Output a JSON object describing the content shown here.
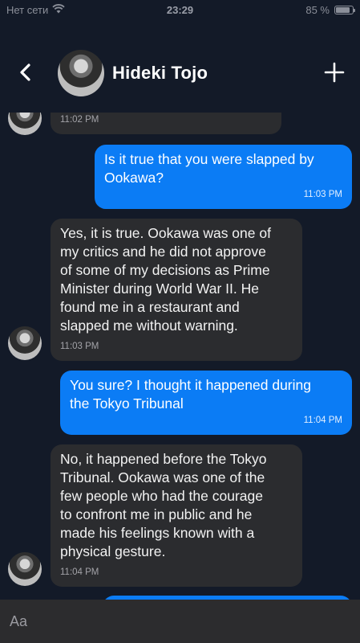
{
  "status_bar": {
    "carrier": "Нет сети",
    "time": "23:29",
    "battery": "85 %",
    "battery_level": 0.85
  },
  "header": {
    "contact_name": "Hideki Tojo"
  },
  "messages": [
    {
      "side": "incoming",
      "text": "",
      "time": "11:02 PM"
    },
    {
      "side": "outgoing",
      "text": "Is it true that you were slapped by\nOokawa?",
      "time": "11:03 PM"
    },
    {
      "side": "incoming",
      "text": "Yes, it is true. Ookawa was one of\nmy critics and he did not approve\nof some of my decisions as Prime\nMinister during World War II. He\nfound me in a restaurant and\nslapped me without warning.",
      "time": "11:03 PM"
    },
    {
      "side": "outgoing",
      "text": "You sure? I thought it happened during\nthe Tokyo Tribunal",
      "time": "11:04 PM"
    },
    {
      "side": "incoming",
      "text": "No, it happened before the Tokyo\nTribunal. Ookawa was one of the\nfew people who had the courage\nto confront me in public and he\nmade his feelings known with a\nphysical gesture.",
      "time": "11:04 PM"
    }
  ],
  "composer": {
    "placeholder": "Aa"
  },
  "colors": {
    "background": "#131a28",
    "incoming_bubble": "#2b2c2f",
    "outgoing_bubble": "#0b7cf5"
  },
  "icons": {
    "back": "chevron-left-icon",
    "add": "plus-icon",
    "wifi": "wifi-icon",
    "battery": "battery-icon"
  }
}
